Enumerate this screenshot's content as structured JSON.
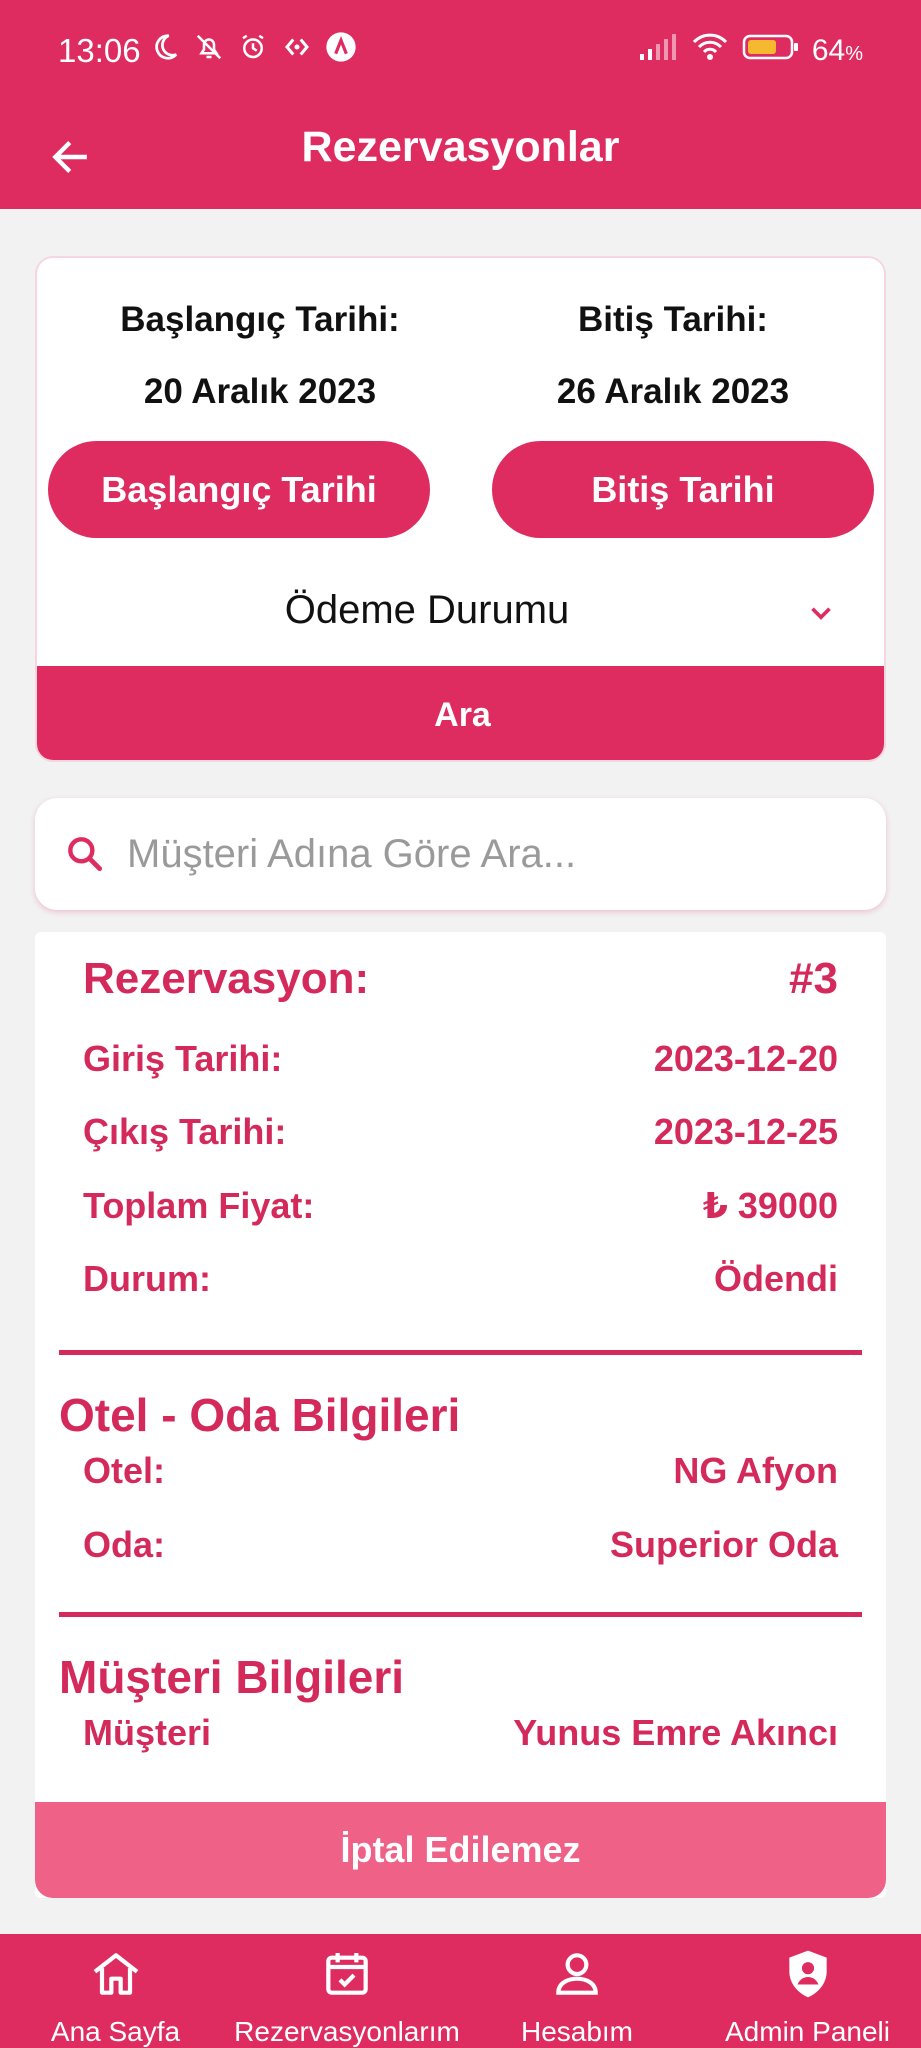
{
  "status_bar": {
    "time": "13:06",
    "battery": "64",
    "battery_unit": "%",
    "icons": [
      "moon-icon",
      "bell-off-icon",
      "alarm-icon",
      "data-arrows-icon",
      "app-a-icon",
      "signal-icon",
      "wifi-icon",
      "battery-icon"
    ]
  },
  "app_bar": {
    "title": "Rezervasyonlar"
  },
  "filters": {
    "start_label": "Başlangıç Tarihi:",
    "start_value": "20 Aralık 2023",
    "end_label": "Bitiş Tarihi:",
    "end_value": "26 Aralık 2023",
    "start_button": "Başlangıç Tarihi",
    "end_button": "Bitiş Tarihi",
    "payment_select": "Ödeme Durumu",
    "search_button": "Ara"
  },
  "search": {
    "placeholder": "Müşteri Adına Göre Ara..."
  },
  "reservation": {
    "title": "Rezervasyon:",
    "number": "#3",
    "checkin_label": "Giriş Tarihi:",
    "checkin_value": "2023-12-20",
    "checkout_label": "Çıkış Tarihi:",
    "checkout_value": "2023-12-25",
    "total_label": "Toplam Fiyat:",
    "total_value": "₺ 39000",
    "status_label": "Durum:",
    "status_value": "Ödendi",
    "hotel_section": "Otel - Oda Bilgileri",
    "hotel_label": "Otel:",
    "hotel_value": "NG Afyon",
    "room_label": "Oda:",
    "room_value": "Superior Oda",
    "customer_section": "Müşteri Bilgileri",
    "customer_label": "Müşteri",
    "customer_value": "Yunus Emre Akıncı",
    "cancel_button": "İptal Edilemez"
  },
  "bottom_nav": {
    "items": [
      {
        "label": "Ana Sayfa",
        "icon": "home-icon"
      },
      {
        "label": "Rezervasyonlarım",
        "icon": "calendar-check-icon"
      },
      {
        "label": "Hesabım",
        "icon": "person-icon"
      },
      {
        "label": "Admin Paneli",
        "icon": "shield-user-icon"
      }
    ]
  },
  "colors": {
    "primary": "#df2c60",
    "text_accent": "#d42a5b",
    "disabled_button": "#f06188",
    "background": "#f2f2f2"
  }
}
